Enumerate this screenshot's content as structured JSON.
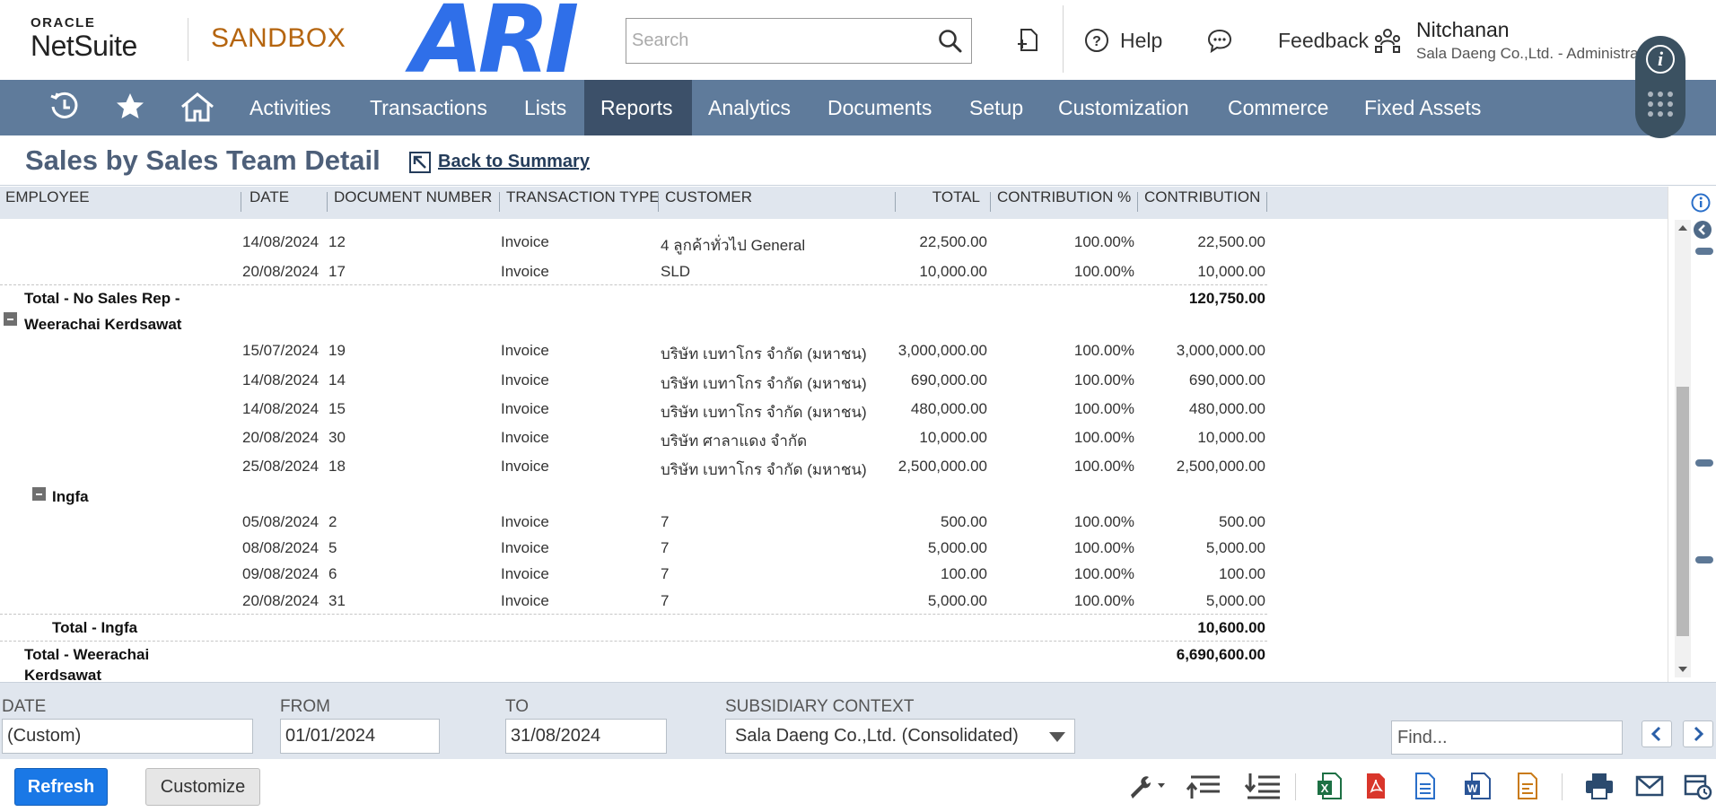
{
  "header": {
    "logo_line1": "ORACLE",
    "logo_line2": "NetSuite",
    "environment": "SANDBOX",
    "brand_mark": "ARI",
    "search_placeholder": "Search",
    "help_label": "Help",
    "feedback_label": "Feedback",
    "user_name": "Nitchanan",
    "user_role": "Sala Daeng Co.,Ltd. - Administrator"
  },
  "nav": {
    "items": [
      {
        "label": "Activities",
        "active": false
      },
      {
        "label": "Transactions",
        "active": false
      },
      {
        "label": "Lists",
        "active": false
      },
      {
        "label": "Reports",
        "active": true
      },
      {
        "label": "Analytics",
        "active": false
      },
      {
        "label": "Documents",
        "active": false
      },
      {
        "label": "Setup",
        "active": false
      },
      {
        "label": "Customization",
        "active": false
      },
      {
        "label": "Commerce",
        "active": false
      },
      {
        "label": "Fixed Assets",
        "active": false
      }
    ]
  },
  "page": {
    "title": "Sales by Sales Team Detail",
    "back_link": "Back to Summary"
  },
  "table": {
    "columns": [
      "Employee",
      "Date",
      "Document Number",
      "Transaction Type",
      "Customer",
      "Total",
      "Contribution %",
      "Contribution"
    ],
    "rows": [
      {
        "kind": "data",
        "date": "14/08/2024",
        "doc": "12",
        "type": "Invoice",
        "customer": "4 ลูกค้าทั่วไป General",
        "total": "22,500.00",
        "pct": "100.00%",
        "contribution": "22,500.00"
      },
      {
        "kind": "data",
        "date": "20/08/2024",
        "doc": "17",
        "type": "Invoice",
        "customer": "SLD",
        "total": "10,000.00",
        "pct": "100.00%",
        "contribution": "10,000.00"
      },
      {
        "kind": "total",
        "label": "Total - No Sales Rep -",
        "contribution": "120,750.00"
      },
      {
        "kind": "group",
        "label": "Weerachai Kerdsawat"
      },
      {
        "kind": "data",
        "date": "15/07/2024",
        "doc": "19",
        "type": "Invoice",
        "customer": "บริษัท เบทาโกร จำกัด (มหาชน)",
        "total": "3,000,000.00",
        "pct": "100.00%",
        "contribution": "3,000,000.00"
      },
      {
        "kind": "data",
        "date": "14/08/2024",
        "doc": "14",
        "type": "Invoice",
        "customer": "บริษัท เบทาโกร จำกัด (มหาชน)",
        "total": "690,000.00",
        "pct": "100.00%",
        "contribution": "690,000.00"
      },
      {
        "kind": "data",
        "date": "14/08/2024",
        "doc": "15",
        "type": "Invoice",
        "customer": "บริษัท เบทาโกร จำกัด (มหาชน)",
        "total": "480,000.00",
        "pct": "100.00%",
        "contribution": "480,000.00"
      },
      {
        "kind": "data",
        "date": "20/08/2024",
        "doc": "30",
        "type": "Invoice",
        "customer": "บริษัท ศาลาแดง จำกัด",
        "total": "10,000.00",
        "pct": "100.00%",
        "contribution": "10,000.00"
      },
      {
        "kind": "data",
        "date": "25/08/2024",
        "doc": "18",
        "type": "Invoice",
        "customer": "บริษัท เบทาโกร จำกัด (มหาชน)",
        "total": "2,500,000.00",
        "pct": "100.00%",
        "contribution": "2,500,000.00"
      },
      {
        "kind": "subgroup",
        "label": "Ingfa"
      },
      {
        "kind": "data",
        "date": "05/08/2024",
        "doc": "2",
        "type": "Invoice",
        "customer": "7",
        "total": "500.00",
        "pct": "100.00%",
        "contribution": "500.00"
      },
      {
        "kind": "data",
        "date": "08/08/2024",
        "doc": "5",
        "type": "Invoice",
        "customer": "7",
        "total": "5,000.00",
        "pct": "100.00%",
        "contribution": "5,000.00"
      },
      {
        "kind": "data",
        "date": "09/08/2024",
        "doc": "6",
        "type": "Invoice",
        "customer": "7",
        "total": "100.00",
        "pct": "100.00%",
        "contribution": "100.00"
      },
      {
        "kind": "data",
        "date": "20/08/2024",
        "doc": "31",
        "type": "Invoice",
        "customer": "7",
        "total": "5,000.00",
        "pct": "100.00%",
        "contribution": "5,000.00"
      },
      {
        "kind": "subtotal",
        "label": "Total - Ingfa",
        "contribution": "10,600.00"
      },
      {
        "kind": "total2",
        "label_line1": "Total - Weerachai",
        "label_line2": "Kerdsawat",
        "contribution": "6,690,600.00"
      }
    ]
  },
  "filters": {
    "date_label": "Date",
    "date_value": "(Custom)",
    "from_label": "From",
    "from_value": "01/01/2024",
    "to_label": "To",
    "to_value": "31/08/2024",
    "subsidiary_label": "Subsidiary Context",
    "subsidiary_value": "Sala Daeng Co.,Ltd. (Consolidated)",
    "find_placeholder": "Find..."
  },
  "footer": {
    "refresh_label": "Refresh",
    "customize_label": "Customize"
  },
  "colors": {
    "nav_bg": "#5f7b9b",
    "nav_active": "#3c5069",
    "brand_blue": "#2f6fe9",
    "sandbox_orange": "#b5650f",
    "refresh_blue": "#1a78e6"
  }
}
